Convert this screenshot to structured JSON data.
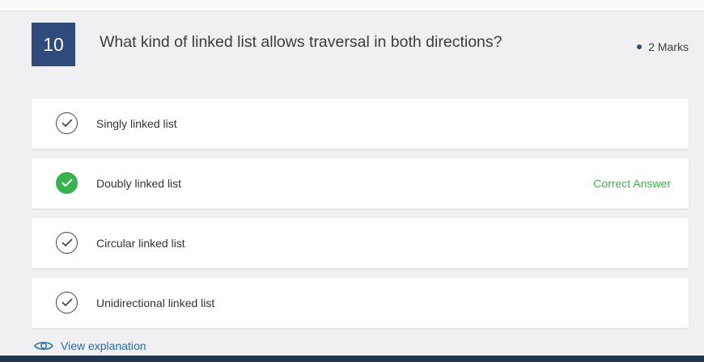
{
  "question": {
    "number": "10",
    "text": "What kind of linked list allows traversal in both directions?",
    "marks": "2 Marks"
  },
  "options": [
    {
      "label": "Singly linked list",
      "correct": false
    },
    {
      "label": "Doubly linked list",
      "correct": true,
      "badge": "Correct Answer"
    },
    {
      "label": "Circular linked list",
      "correct": false
    },
    {
      "label": "Unidirectional linked list",
      "correct": false
    }
  ],
  "explanation_link": {
    "label": "View explanation",
    "icon": "eye-icon"
  },
  "colors": {
    "accent": "#2f4b7c",
    "correct": "#37b24d",
    "link": "#2a6aa6"
  }
}
